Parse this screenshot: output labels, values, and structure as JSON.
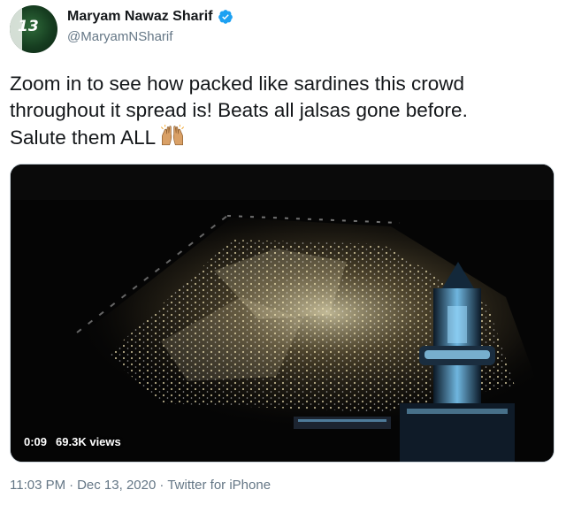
{
  "author": {
    "name": "Maryam Nawaz Sharif",
    "handle": "@MaryamNSharif",
    "verified": true,
    "avatar_badge": "13",
    "verified_icon": "verified-badge-icon"
  },
  "tweet": {
    "lines": [
      "Zoom in to see how packed like sardines this crowd",
      "throughout it spread is! Beats all jalsas gone before.",
      "Salute them ALL"
    ],
    "emoji": "raising-hands-emoji"
  },
  "video": {
    "elapsed": "0:09",
    "views": "69.3K views"
  },
  "footer": {
    "time": "11:03 PM",
    "separator1": "·",
    "date": "Dec 13, 2020",
    "separator2": "·",
    "source": "Twitter for iPhone"
  },
  "colors": {
    "text": "#14171a",
    "secondary": "#657786",
    "verified_blue": "#1da1f2",
    "border": "#ccd6dd"
  }
}
